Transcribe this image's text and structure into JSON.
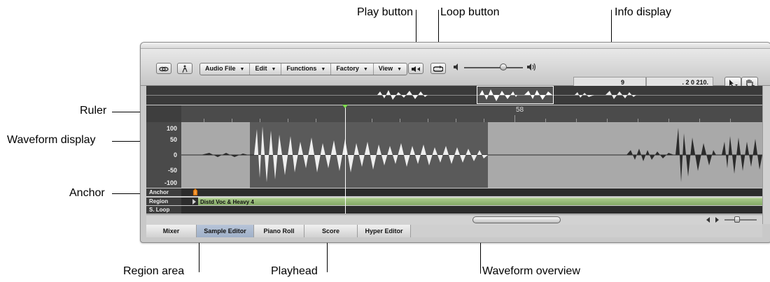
{
  "callouts": {
    "play_button": "Play button",
    "loop_button": "Loop button",
    "info_display": "Info display",
    "ruler": "Ruler",
    "waveform_display": "Waveform display",
    "anchor": "Anchor",
    "region_area": "Region area",
    "playhead": "Playhead",
    "waveform_overview": "Waveform overview"
  },
  "toolbar": {
    "menus": [
      {
        "label": "Audio File"
      },
      {
        "label": "Edit"
      },
      {
        "label": "Functions"
      },
      {
        "label": "Factory"
      },
      {
        "label": "View"
      }
    ],
    "info": {
      "position": "9",
      "fraction": ". 2  0 210."
    }
  },
  "ruler": {
    "bar_number": "58"
  },
  "wave_axis": {
    "labels": [
      "100",
      "50",
      "0",
      "-50",
      "-100"
    ]
  },
  "rows": {
    "anchor": "Anchor",
    "region": "Region",
    "s_loop": "S. Loop"
  },
  "region": {
    "name": "Distd Voc & Heavy 4"
  },
  "tabs": [
    {
      "label": "Mixer",
      "active": false
    },
    {
      "label": "Sample Editor",
      "active": true
    },
    {
      "label": "Piano Roll",
      "active": false
    },
    {
      "label": "Score",
      "active": false
    },
    {
      "label": "Hyper Editor",
      "active": false
    }
  ],
  "icons": {
    "link": "link-icon",
    "catch": "catch-icon",
    "play": "play-icon",
    "loop": "loop-icon",
    "volume_low": "speaker-low-icon",
    "volume_high": "speaker-high-icon",
    "pointer": "pointer-tool-icon",
    "hand": "hand-tool-icon"
  },
  "colors": {
    "region_green": "#8fb36f",
    "playhead_marker": "#7fe04e",
    "anchor_orange": "#f08a1c"
  }
}
